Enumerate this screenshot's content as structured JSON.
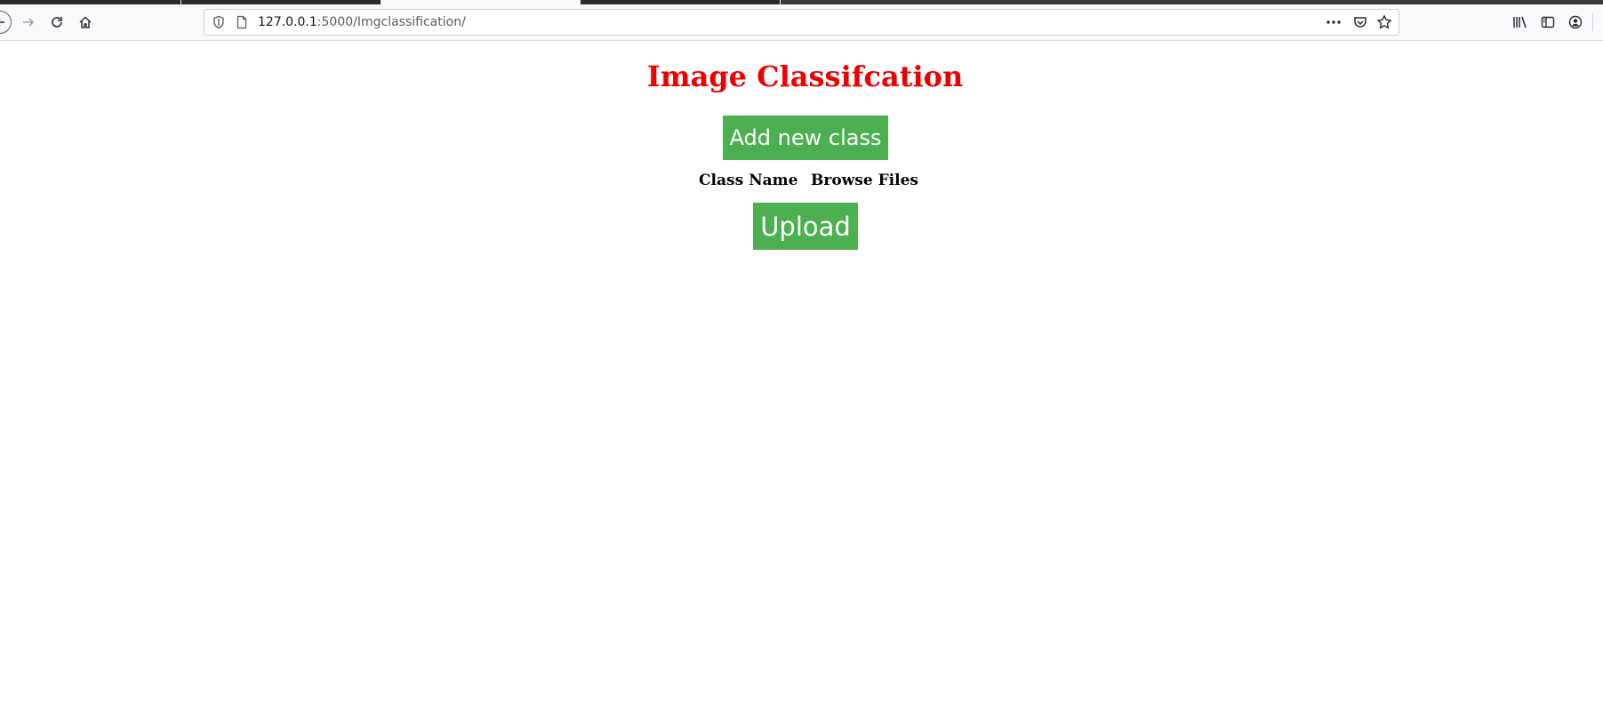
{
  "browser": {
    "url_host": "127.0.0.1",
    "url_path": ":5000/Imgclassification/"
  },
  "icons": {
    "back": "back-arrow-icon",
    "forward": "forward-arrow-icon",
    "reload": "reload-icon",
    "home": "home-icon",
    "shield": "tracking-shield-icon",
    "page": "page-icon",
    "more": "more-dots-icon",
    "pocket": "pocket-icon",
    "bookmark": "star-icon",
    "library": "library-icon",
    "sidebar": "sidebar-icon",
    "account": "account-icon"
  },
  "page": {
    "title": "Image Classifcation",
    "add_class_label": "Add new class",
    "columns": {
      "class_name": "Class Name",
      "browse_files": "Browse Files"
    },
    "upload_label": "Upload"
  },
  "colors": {
    "title": "#ee0000",
    "button_bg": "#4caf50",
    "button_text": "#ffffff"
  }
}
